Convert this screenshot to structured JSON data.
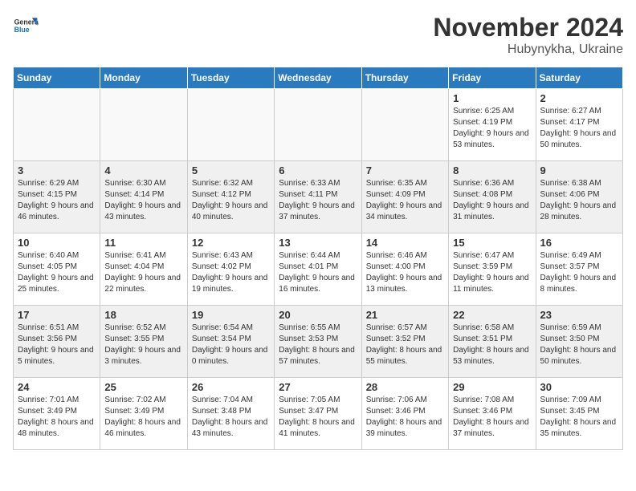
{
  "logo": {
    "line1": "General",
    "line2": "Blue"
  },
  "title": "November 2024",
  "subtitle": "Hubynykha, Ukraine",
  "days_of_week": [
    "Sunday",
    "Monday",
    "Tuesday",
    "Wednesday",
    "Thursday",
    "Friday",
    "Saturday"
  ],
  "weeks": [
    [
      {
        "day": "",
        "info": ""
      },
      {
        "day": "",
        "info": ""
      },
      {
        "day": "",
        "info": ""
      },
      {
        "day": "",
        "info": ""
      },
      {
        "day": "",
        "info": ""
      },
      {
        "day": "1",
        "info": "Sunrise: 6:25 AM\nSunset: 4:19 PM\nDaylight: 9 hours and 53 minutes."
      },
      {
        "day": "2",
        "info": "Sunrise: 6:27 AM\nSunset: 4:17 PM\nDaylight: 9 hours and 50 minutes."
      }
    ],
    [
      {
        "day": "3",
        "info": "Sunrise: 6:29 AM\nSunset: 4:15 PM\nDaylight: 9 hours and 46 minutes."
      },
      {
        "day": "4",
        "info": "Sunrise: 6:30 AM\nSunset: 4:14 PM\nDaylight: 9 hours and 43 minutes."
      },
      {
        "day": "5",
        "info": "Sunrise: 6:32 AM\nSunset: 4:12 PM\nDaylight: 9 hours and 40 minutes."
      },
      {
        "day": "6",
        "info": "Sunrise: 6:33 AM\nSunset: 4:11 PM\nDaylight: 9 hours and 37 minutes."
      },
      {
        "day": "7",
        "info": "Sunrise: 6:35 AM\nSunset: 4:09 PM\nDaylight: 9 hours and 34 minutes."
      },
      {
        "day": "8",
        "info": "Sunrise: 6:36 AM\nSunset: 4:08 PM\nDaylight: 9 hours and 31 minutes."
      },
      {
        "day": "9",
        "info": "Sunrise: 6:38 AM\nSunset: 4:06 PM\nDaylight: 9 hours and 28 minutes."
      }
    ],
    [
      {
        "day": "10",
        "info": "Sunrise: 6:40 AM\nSunset: 4:05 PM\nDaylight: 9 hours and 25 minutes."
      },
      {
        "day": "11",
        "info": "Sunrise: 6:41 AM\nSunset: 4:04 PM\nDaylight: 9 hours and 22 minutes."
      },
      {
        "day": "12",
        "info": "Sunrise: 6:43 AM\nSunset: 4:02 PM\nDaylight: 9 hours and 19 minutes."
      },
      {
        "day": "13",
        "info": "Sunrise: 6:44 AM\nSunset: 4:01 PM\nDaylight: 9 hours and 16 minutes."
      },
      {
        "day": "14",
        "info": "Sunrise: 6:46 AM\nSunset: 4:00 PM\nDaylight: 9 hours and 13 minutes."
      },
      {
        "day": "15",
        "info": "Sunrise: 6:47 AM\nSunset: 3:59 PM\nDaylight: 9 hours and 11 minutes."
      },
      {
        "day": "16",
        "info": "Sunrise: 6:49 AM\nSunset: 3:57 PM\nDaylight: 9 hours and 8 minutes."
      }
    ],
    [
      {
        "day": "17",
        "info": "Sunrise: 6:51 AM\nSunset: 3:56 PM\nDaylight: 9 hours and 5 minutes."
      },
      {
        "day": "18",
        "info": "Sunrise: 6:52 AM\nSunset: 3:55 PM\nDaylight: 9 hours and 3 minutes."
      },
      {
        "day": "19",
        "info": "Sunrise: 6:54 AM\nSunset: 3:54 PM\nDaylight: 9 hours and 0 minutes."
      },
      {
        "day": "20",
        "info": "Sunrise: 6:55 AM\nSunset: 3:53 PM\nDaylight: 8 hours and 57 minutes."
      },
      {
        "day": "21",
        "info": "Sunrise: 6:57 AM\nSunset: 3:52 PM\nDaylight: 8 hours and 55 minutes."
      },
      {
        "day": "22",
        "info": "Sunrise: 6:58 AM\nSunset: 3:51 PM\nDaylight: 8 hours and 53 minutes."
      },
      {
        "day": "23",
        "info": "Sunrise: 6:59 AM\nSunset: 3:50 PM\nDaylight: 8 hours and 50 minutes."
      }
    ],
    [
      {
        "day": "24",
        "info": "Sunrise: 7:01 AM\nSunset: 3:49 PM\nDaylight: 8 hours and 48 minutes."
      },
      {
        "day": "25",
        "info": "Sunrise: 7:02 AM\nSunset: 3:49 PM\nDaylight: 8 hours and 46 minutes."
      },
      {
        "day": "26",
        "info": "Sunrise: 7:04 AM\nSunset: 3:48 PM\nDaylight: 8 hours and 43 minutes."
      },
      {
        "day": "27",
        "info": "Sunrise: 7:05 AM\nSunset: 3:47 PM\nDaylight: 8 hours and 41 minutes."
      },
      {
        "day": "28",
        "info": "Sunrise: 7:06 AM\nSunset: 3:46 PM\nDaylight: 8 hours and 39 minutes."
      },
      {
        "day": "29",
        "info": "Sunrise: 7:08 AM\nSunset: 3:46 PM\nDaylight: 8 hours and 37 minutes."
      },
      {
        "day": "30",
        "info": "Sunrise: 7:09 AM\nSunset: 3:45 PM\nDaylight: 8 hours and 35 minutes."
      }
    ]
  ]
}
